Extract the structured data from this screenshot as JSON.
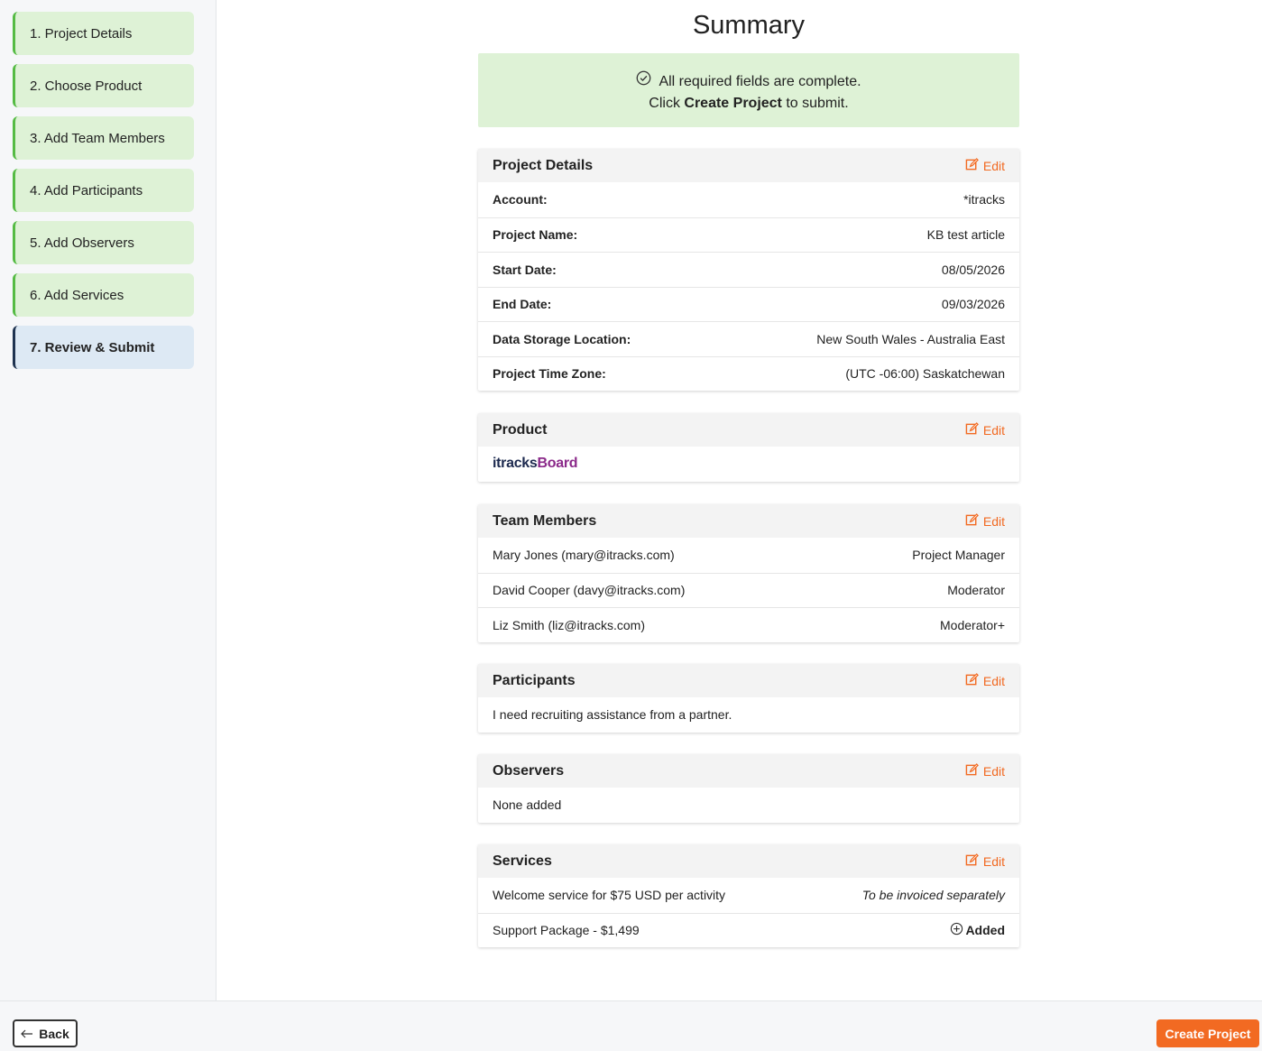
{
  "steps": [
    {
      "label": "1. Project Details"
    },
    {
      "label": "2. Choose Product"
    },
    {
      "label": "3. Add Team Members"
    },
    {
      "label": "4. Add Participants"
    },
    {
      "label": "5. Add Observers"
    },
    {
      "label": "6. Add Services"
    },
    {
      "label": "7. Review & Submit"
    }
  ],
  "page_title": "Summary",
  "notice": {
    "line1": "All required fields are complete.",
    "line2_pre": "Click ",
    "line2_bold": "Create Project",
    "line2_post": " to submit."
  },
  "edit_label": "Edit",
  "project_details": {
    "title": "Project Details",
    "rows": [
      {
        "label": "Account:",
        "value": "*itracks"
      },
      {
        "label": "Project Name:",
        "value": "KB test article"
      },
      {
        "label": "Start Date:",
        "value": "08/05/2026"
      },
      {
        "label": "End Date:",
        "value": "09/03/2026"
      },
      {
        "label": "Data Storage Location:",
        "value": "New South Wales - Australia East"
      },
      {
        "label": "Project Time Zone:",
        "value": "(UTC -06:00) Saskatchewan"
      }
    ]
  },
  "product": {
    "title": "Product",
    "logo_part1": "itracks",
    "logo_part2": "Board"
  },
  "team_members": {
    "title": "Team Members",
    "rows": [
      {
        "name": "Mary Jones (mary@itracks.com)",
        "role": "Project Manager"
      },
      {
        "name": "David Cooper (davy@itracks.com)",
        "role": "Moderator"
      },
      {
        "name": "Liz Smith (liz@itracks.com)",
        "role": "Moderator+"
      }
    ]
  },
  "participants": {
    "title": "Participants",
    "text": "I need recruiting assistance from a partner."
  },
  "observers": {
    "title": "Observers",
    "text": "None added"
  },
  "services": {
    "title": "Services",
    "rows": [
      {
        "name": "Welcome service for $75 USD per activity",
        "status": "To be invoiced separately"
      },
      {
        "name": "Support Package - $1,499",
        "status": "Added"
      }
    ]
  },
  "footer": {
    "back_label": "Back",
    "create_label": "Create Project"
  },
  "colors": {
    "accent": "#f26a22",
    "step_complete": "#def2d6",
    "step_complete_border": "#55bb44",
    "step_active": "#dde9f4",
    "step_active_border": "#1f3350"
  },
  "icons": {
    "notice": "check-circle-icon",
    "edit": "edit-icon",
    "added": "plus-circle-icon",
    "back": "arrow-left-icon"
  }
}
